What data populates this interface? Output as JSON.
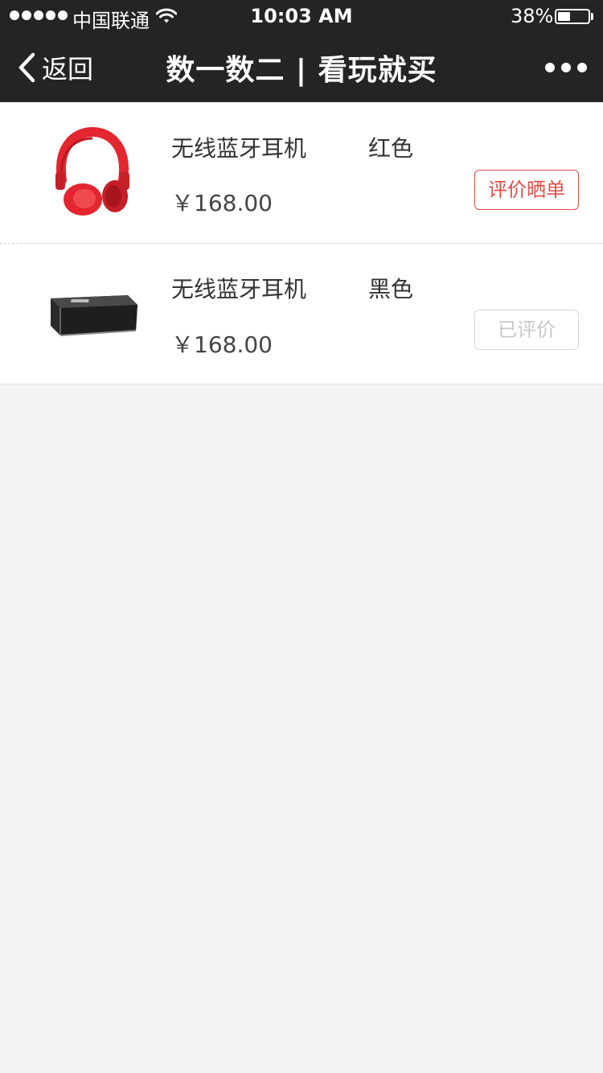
{
  "status_bar": {
    "carrier": "中国联通",
    "time": "10:03 AM",
    "battery_percent": "38%",
    "battery_level": 0.38,
    "signal_icon": "signal-dots-icon",
    "wifi_icon": "wifi-icon"
  },
  "nav": {
    "back_label": "返回",
    "title": "数一数二 | 看玩就买",
    "back_icon": "chevron-left-icon",
    "more_icon": "more-dots-icon"
  },
  "colors": {
    "nav_bg": "#252323",
    "accent": "#e14d45",
    "disabled": "#c8c8c8",
    "page_bg": "#f3f3f3"
  },
  "items": [
    {
      "name": "无线蓝牙耳机",
      "color": "红色",
      "price": "￥168.00",
      "image_icon": "red-headphones-image",
      "action_label": "评价晒单",
      "action_state": "active"
    },
    {
      "name": "无线蓝牙耳机",
      "color": "黑色",
      "price": "￥168.00",
      "image_icon": "black-speaker-image",
      "action_label": "已评价",
      "action_state": "disabled"
    }
  ]
}
